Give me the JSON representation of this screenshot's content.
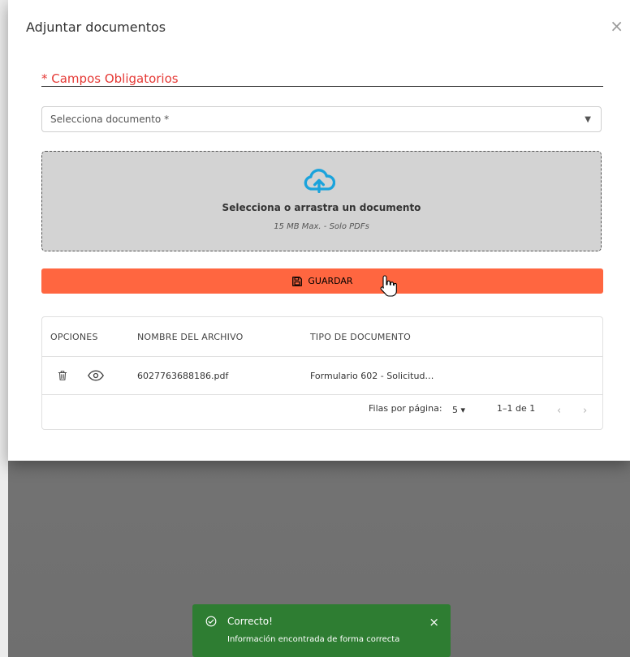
{
  "dialog": {
    "title": "Adjuntar documentos",
    "close_symbol": "×",
    "required_note": "* Campos Obligatorios",
    "select_label": "Selecciona documento *",
    "select_arrow": "▼",
    "dropzone": {
      "icon": "cloud-upload-icon",
      "title": "Selecciona o arrastra un documento",
      "subtitle": "15 MB Max. - Solo PDFs"
    },
    "save_button": "GUARDAR"
  },
  "table": {
    "headers": {
      "options": "OPCIONES",
      "filename": "NOMBRE DEL ARCHIVO",
      "doctype": "TIPO DE DOCUMENTO"
    },
    "rows": [
      {
        "filename": "6027763688186.pdf",
        "doctype": "Formulario 602 - Solicitud…"
      }
    ],
    "pagination": {
      "rows_per_page_label": "Filas por página:",
      "rows_per_page": "5 ▾",
      "range": "1–1 de 1",
      "prev": "‹",
      "next": "›"
    }
  },
  "toast": {
    "title": "Correcto!",
    "message": "Información encontrada de forma correcta",
    "close_symbol": "×"
  },
  "colors": {
    "accent_orange": "#ff6640",
    "required_red": "#e53935",
    "upload_icon": "#1aa3dc",
    "toast_green": "#2e7d32"
  }
}
